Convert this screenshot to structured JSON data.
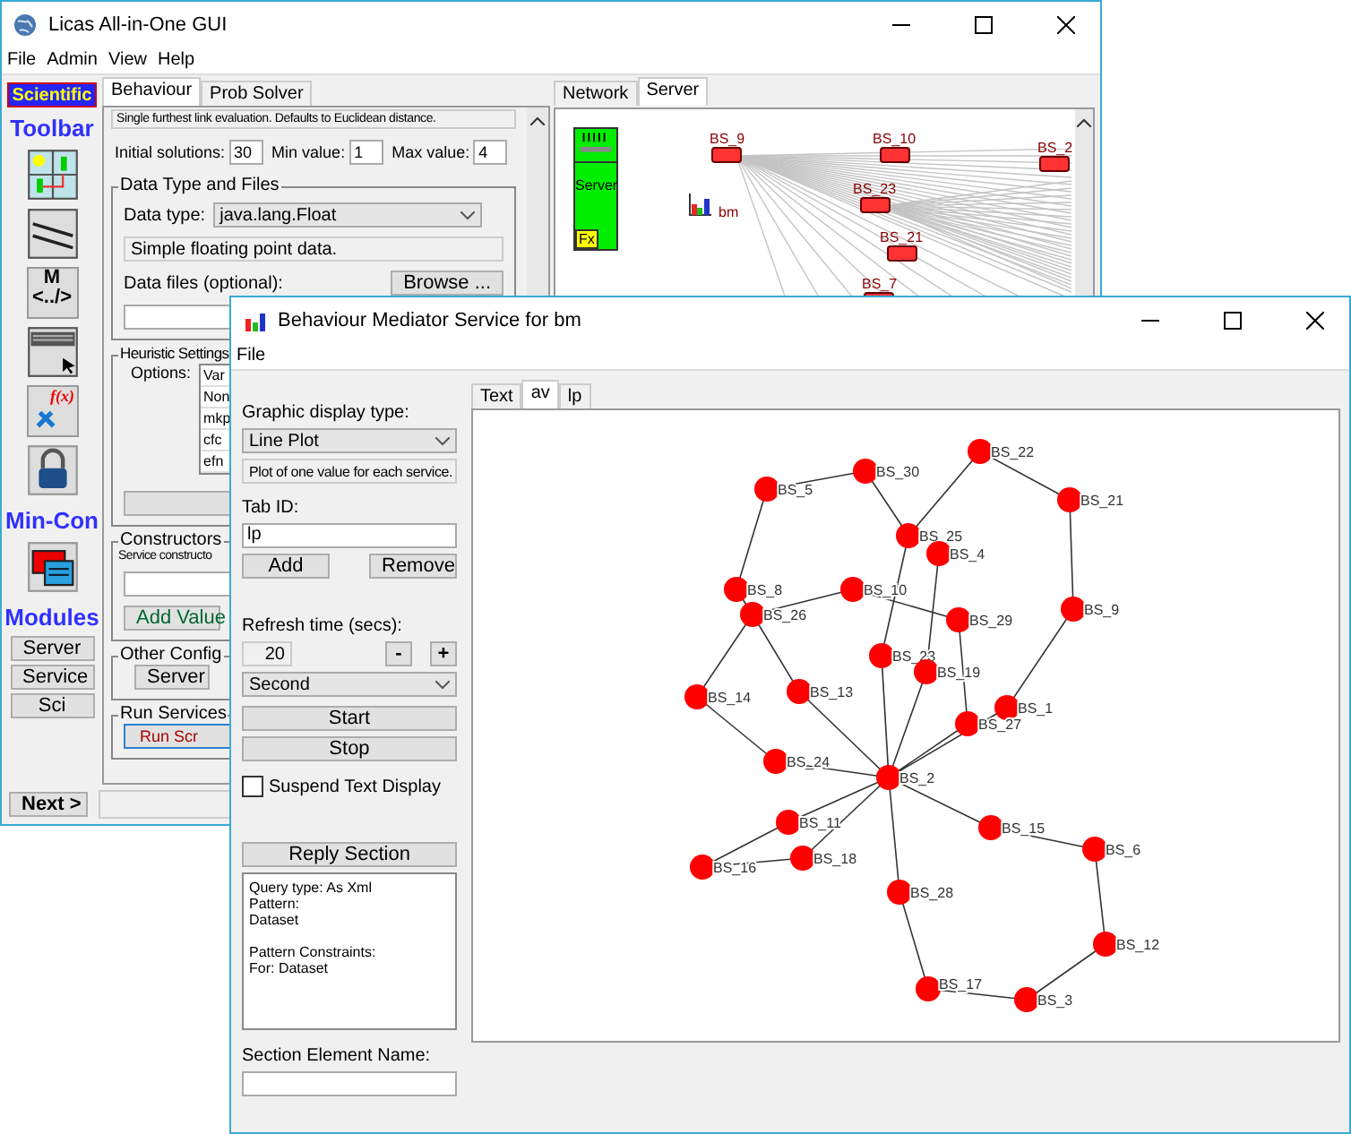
{
  "main_window": {
    "title": "Licas All-in-One GUI",
    "menu": [
      "File",
      "Admin",
      "View",
      "Help"
    ],
    "toolbar": {
      "mode_button": "Scientific",
      "toolbar_heading": "Toolbar",
      "tools": [
        {
          "kind": "grid"
        },
        {
          "kind": "lines"
        },
        {
          "kind": "markup",
          "text": "M",
          "subtext": "<../>"
        },
        {
          "kind": "list"
        },
        {
          "kind": "function",
          "text": "f(x)"
        },
        {
          "kind": "lock"
        }
      ],
      "mincon_heading": "Min-Con",
      "mincon_tool": {
        "kind": "windows"
      },
      "modules_heading": "Modules",
      "module_buttons": [
        "Server",
        "Service",
        "Sci"
      ]
    },
    "tabs": [
      {
        "label": "Behaviour",
        "selected": true
      },
      {
        "label": "Prob Solver",
        "selected": false
      }
    ],
    "behaviour": {
      "description": "Single furthest link evaluation. Defaults to Euclidean distance.",
      "numbers": [
        {
          "label": "Initial solutions:",
          "value": "30"
        },
        {
          "label": "Min value:",
          "value": "1"
        },
        {
          "label": "Max value:",
          "value": "4"
        }
      ],
      "data_group": {
        "title": "Data Type and Files",
        "type_label": "Data type:",
        "type_value": "java.lang.Float",
        "type_description": "Simple floating point data.",
        "files_label": "Data files (optional):",
        "browse_button": "Browse ..."
      },
      "heuristic_group": {
        "title": "Heuristic Settings",
        "options_label": "Options:",
        "options": [
          "Var",
          "Non",
          "mkp",
          "cfc",
          "efn"
        ]
      },
      "constructors_group": {
        "title": "Constructors",
        "label": "Service constructo",
        "add_button": "Add Value"
      },
      "other_group": {
        "title": "Other Config",
        "button": "Server"
      },
      "run_group": {
        "title": "Run Services",
        "button": "Run Scr"
      }
    },
    "network_tabs": [
      {
        "label": "Network",
        "selected": false
      },
      {
        "label": "Server",
        "selected": true
      }
    ],
    "server": {
      "label": "Server",
      "badge": "Fx",
      "service_label": "bm",
      "nodes": [
        "BS_9",
        "BS_10",
        "BS_2",
        "BS_23",
        "BS_21",
        "BS_7"
      ]
    },
    "next_button": "Next >"
  },
  "dialog": {
    "title": "Behaviour Mediator Service for bm",
    "menu": [
      "File"
    ],
    "display_type_label": "Graphic display type:",
    "display_type": "Line Plot",
    "display_description": "Plot of one value for each service.",
    "tab_id_label": "Tab ID:",
    "tab_id": "lp",
    "add_button": "Add",
    "remove_button": "Remove",
    "refresh_label": "Refresh time (secs):",
    "refresh_value": "20",
    "minus_button": "-",
    "plus_button": "+",
    "unit": "Second",
    "start_button": "Start",
    "stop_button": "Stop",
    "suspend": {
      "label": "Suspend Text Display",
      "checked": false
    },
    "reply_button": "Reply Section",
    "reply_text": [
      [
        "Query type: As Xml",
        "Pattern:",
        "Dataset"
      ],
      [
        "Pattern Constraints:",
        "For: Dataset"
      ]
    ],
    "element_name_label": "Section Element Name:",
    "tabs": [
      {
        "label": "Text",
        "selected": false
      },
      {
        "label": "av",
        "selected": true
      },
      {
        "label": "lp",
        "selected": false
      }
    ],
    "graph": {
      "nodes": [
        "BS_22",
        "BS_30",
        "BS_5",
        "BS_21",
        "BS_25",
        "BS_4",
        "BS_8",
        "BS_10",
        "BS_26",
        "BS_29",
        "BS_9",
        "BS_23",
        "BS_19",
        "BS_13",
        "BS_14",
        "BS_1",
        "BS_27",
        "BS_24",
        "BS_2",
        "BS_11",
        "BS_15",
        "BS_16",
        "BS_18",
        "BS_6",
        "BS_28",
        "BS_12",
        "BS_17",
        "BS_3"
      ]
    }
  }
}
